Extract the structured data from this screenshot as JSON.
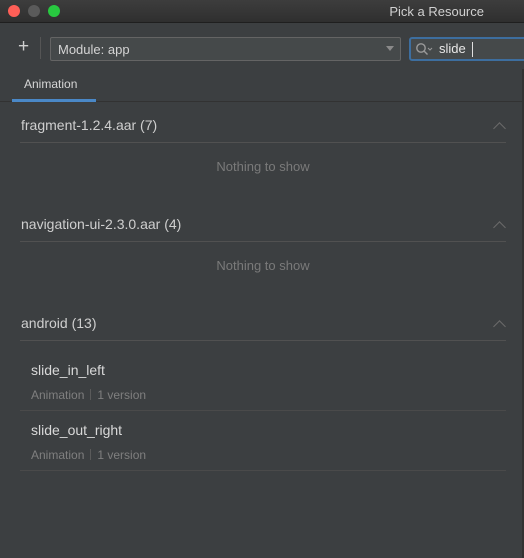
{
  "window": {
    "title": "Pick a Resource"
  },
  "toolbar": {
    "add_label": "+",
    "module_selector": "Module: app",
    "search_value": "slide"
  },
  "tabs": [
    {
      "label": "Animation",
      "selected": true
    }
  ],
  "groups": [
    {
      "title": "fragment-1.2.4.aar (7)",
      "empty_text": "Nothing to show",
      "items": []
    },
    {
      "title": "navigation-ui-2.3.0.aar (4)",
      "empty_text": "Nothing to show",
      "items": []
    },
    {
      "title": "android (13)",
      "items": [
        {
          "name": "slide_in_left",
          "type": "Animation",
          "versions": "1 version"
        },
        {
          "name": "slide_out_right",
          "type": "Animation",
          "versions": "1 version"
        }
      ]
    }
  ],
  "colors": {
    "accent": "#4a88c7",
    "background": "#3c3f41",
    "search_focus": "#3d6e9f"
  }
}
